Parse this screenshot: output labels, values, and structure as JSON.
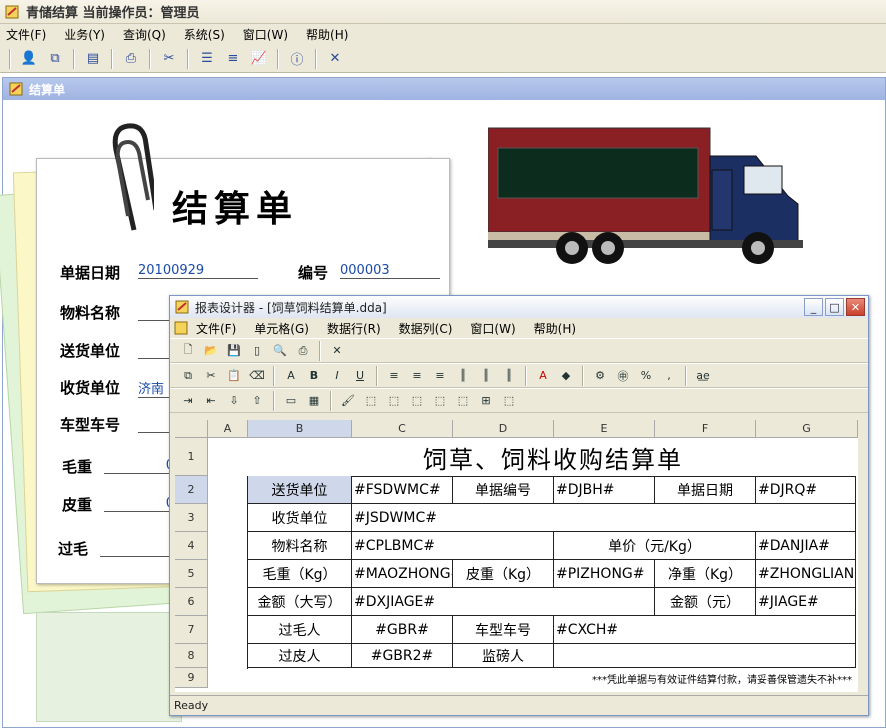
{
  "app": {
    "title": "青储结算   当前操作员：管理员"
  },
  "menu": [
    "文件(F)",
    "业务(Y)",
    "查询(Q)",
    "系统(S)",
    "窗口(W)",
    "帮助(H)"
  ],
  "pane": {
    "title": "结算单"
  },
  "slip": {
    "title": "结算单",
    "date_label": "单据日期",
    "date_value": "20100929",
    "no_label": "编号",
    "no_value": "000003",
    "material_label": "物料名称",
    "sender_label": "送货单位",
    "receiver_label": "收货单位",
    "receiver_value": "济南",
    "vehicle_label": "车型车号",
    "gross_label": "毛重",
    "gross_value": "0",
    "tare_label": "皮重",
    "tare_value": "0",
    "overgross_label": "过毛"
  },
  "designer": {
    "title": "报表设计器 - [饲草饲料结算单.dda]",
    "menu": [
      "文件(F)",
      "单元格(G)",
      "数据行(R)",
      "数据列(C)",
      "窗口(W)",
      "帮助(H)"
    ],
    "columns": [
      "A",
      "B",
      "C",
      "D",
      "E",
      "F",
      "G"
    ],
    "rows": [
      "1",
      "2",
      "3",
      "4",
      "5",
      "6",
      "7",
      "8",
      "9"
    ],
    "sheet_title": "饲草、饲料收购结算单",
    "r2": [
      "送货单位",
      "#FSDWMC#",
      "单据编号",
      "#DJBH#",
      "单据日期",
      "#DJRQ#"
    ],
    "r3": [
      "收货单位",
      "#JSDWMC#"
    ],
    "r4": [
      "物料名称",
      "#CPLBMC#",
      "单价（元/Kg）",
      "#DANJIA#"
    ],
    "r5": [
      "毛重（Kg）",
      "#MAOZHONG#",
      "皮重（Kg）",
      "#PIZHONG#",
      "净重（Kg）",
      "#ZHONGLIANG#"
    ],
    "r6": [
      "金额（大写）",
      "#DXJIAGE#",
      "金额（元）",
      "#JIAGE#"
    ],
    "r7": [
      "过毛人",
      "#GBR#",
      "车型车号",
      "#CXCH#"
    ],
    "r8": [
      "过皮人",
      "#GBR2#",
      "监磅人"
    ],
    "r9_note": "***凭此单据与有效证件结算付款，请妥善保管遗失不补***",
    "status": "Ready"
  }
}
